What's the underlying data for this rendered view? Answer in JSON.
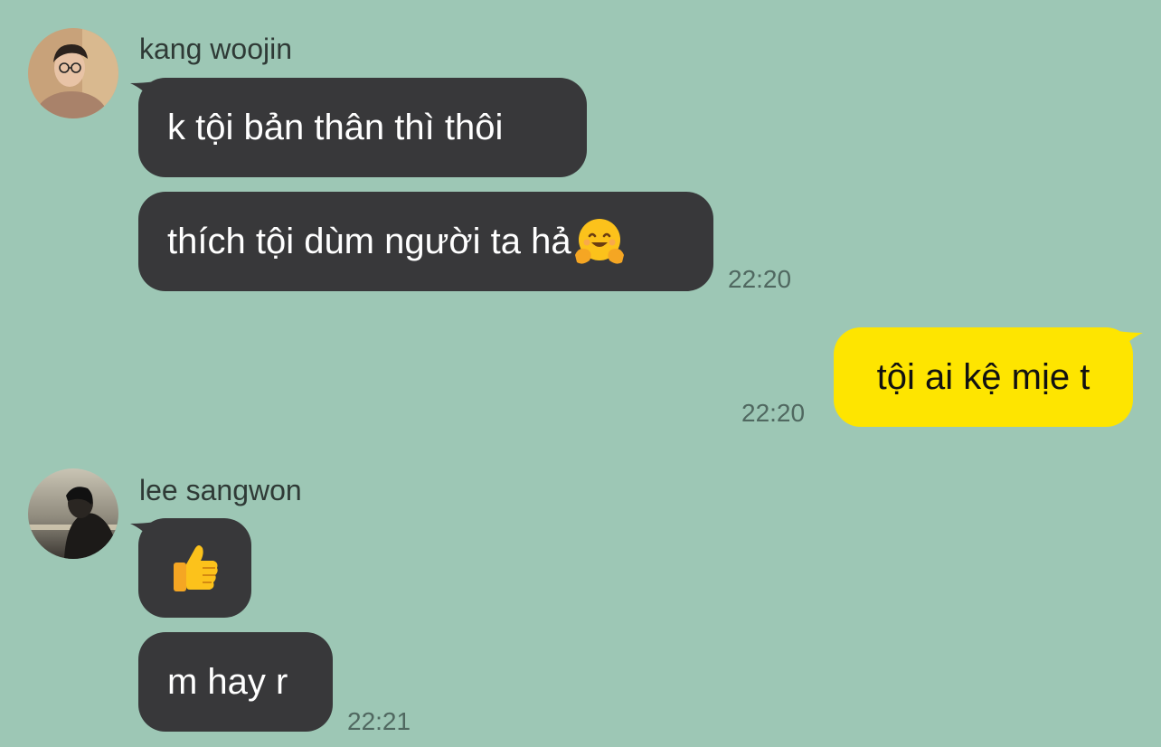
{
  "messages": [
    {
      "sender": "kang woojin",
      "bubbles": [
        "k tội bản thân thì thôi",
        "thích tội dùm người ta hả"
      ],
      "emoji": "smiling-face-with-open-hands",
      "time": "22:20"
    },
    {
      "sender": "me",
      "bubbles": [
        "tội ai kệ mịe t"
      ],
      "time": "22:20"
    },
    {
      "sender": "lee sangwon",
      "bubbles": [
        "👍",
        "m hay r"
      ],
      "time": "22:21"
    }
  ],
  "colors": {
    "background": "#9dc7b5",
    "incoming_bubble": "#38383a",
    "outgoing_bubble": "#fee500"
  }
}
